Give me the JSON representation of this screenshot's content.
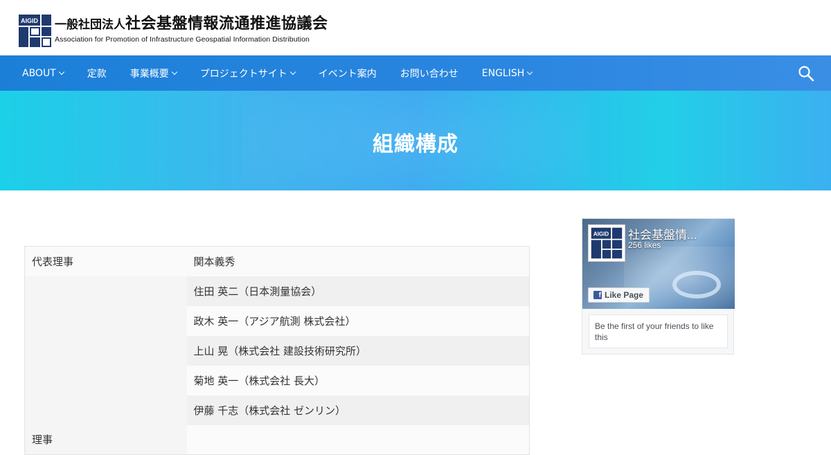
{
  "header": {
    "logo_mark_text": "AIGID",
    "logo_jp_prefix": "一般社団法人",
    "logo_jp_name": "社会基盤情報流通推進協議会",
    "logo_en": "Association for Promotion of Infrastructure Geospatial Information Distribution"
  },
  "nav": {
    "items": [
      {
        "label": "ABOUT",
        "has_submenu": true
      },
      {
        "label": "定款",
        "has_submenu": false
      },
      {
        "label": "事業概要",
        "has_submenu": true
      },
      {
        "label": "プロジェクトサイト",
        "has_submenu": true
      },
      {
        "label": "イベント案内",
        "has_submenu": false
      },
      {
        "label": "お問い合わせ",
        "has_submenu": false
      },
      {
        "label": "ENGLISH",
        "has_submenu": true
      }
    ],
    "search_icon": "search-icon"
  },
  "hero": {
    "title": "組織構成"
  },
  "org_table": {
    "rows": [
      {
        "role": "代表理事",
        "name": "関本義秀"
      },
      {
        "role": "",
        "name": "住田 英二（日本測量協会）"
      },
      {
        "role": "",
        "name": "政木 英一（アジア航測 株式会社）"
      },
      {
        "role": "",
        "name": "上山 晃（株式会社 建設技術研究所）"
      },
      {
        "role": "",
        "name": "菊地 英一（株式会社 長大）"
      },
      {
        "role": "",
        "name": "伊藤 千志（株式会社 ゼンリン）"
      },
      {
        "role": "理事",
        "name": ""
      }
    ]
  },
  "facebook": {
    "page_name": "社会基盤情...",
    "likes": "256 likes",
    "like_button": "Like Page",
    "friends_text": "Be the first of your friends to like this",
    "avatar_text": "AIGID"
  },
  "colors": {
    "nav_bg": "#1b7fd8",
    "hero_start": "#1cd0e8",
    "hero_mid": "#3aaaf0",
    "logo_navy": "#1f3a6e",
    "fb_blue": "#3b5998"
  }
}
